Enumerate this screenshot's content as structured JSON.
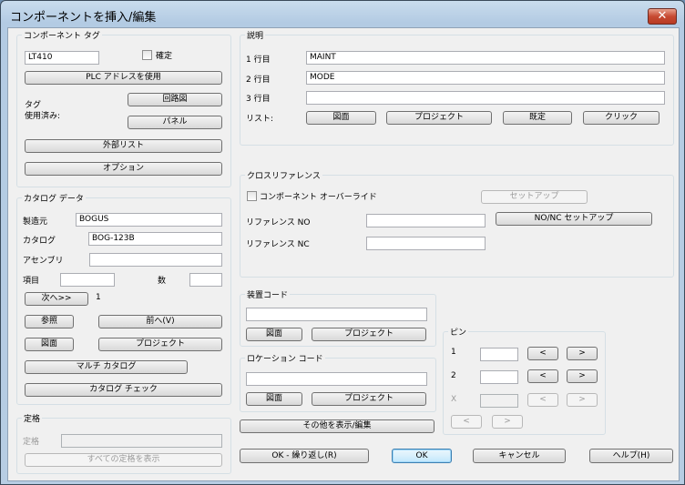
{
  "window": {
    "title": "コンポーネントを挿入/編集",
    "close_glyph": "✕"
  },
  "component_tag": {
    "legend": "コンポーネント タグ",
    "tag_value": "LT410",
    "fixed_label": "確定",
    "plc_button": "PLC アドレスを使用",
    "tags_used_label": "タグ\n使用済み:",
    "schematic_button": "回路図",
    "panel_button": "パネル",
    "external_list_button": "外部リスト",
    "options_button": "オプション"
  },
  "catalog": {
    "legend": "カタログ データ",
    "manufacturer_label": "製造元",
    "manufacturer_value": "BOGUS",
    "catalog_label": "カタログ",
    "catalog_value": "BOG-123B",
    "assembly_label": "アセンブリ",
    "assembly_value": "",
    "item_label": "項目",
    "item_value": "",
    "count_label": "数",
    "count_value": "",
    "next_button": "次へ>>",
    "next_value": "1",
    "lookup_button": "参照",
    "previous_button": "前へ(V)",
    "drawing_button": "図面",
    "project_button": "プロジェクト",
    "multi_catalog_button": "マルチ カタログ",
    "catalog_check_button": "カタログ チェック"
  },
  "rating": {
    "legend": "定格",
    "rating_label": "定格",
    "rating_value": "",
    "show_all_button": "すべての定格を表示"
  },
  "description": {
    "legend": "説明",
    "line1_label": "1 行目",
    "line1_value": "MAINT",
    "line2_label": "2 行目",
    "line2_value": "MODE",
    "line3_label": "3 行目",
    "line3_value": "",
    "list_label": "リスト:",
    "drawing_button": "図面",
    "project_button": "プロジェクト",
    "defaults_button": "既定",
    "pick_button": "クリック"
  },
  "cross_reference": {
    "legend": "クロスリファレンス",
    "override_label": "コンポーネント オーバーライド",
    "setup_button": "セットアップ",
    "ref_no_label": "リファレンス NO",
    "ref_no_value": "",
    "ref_nc_label": "リファレンス NC",
    "ref_nc_value": "",
    "nonc_setup_button": "NO/NC セットアップ"
  },
  "installation_code": {
    "legend": "装置コード",
    "value": "",
    "drawing_button": "図面",
    "project_button": "プロジェクト"
  },
  "location_code": {
    "legend": "ロケーション コード",
    "value": "",
    "drawing_button": "図面",
    "project_button": "プロジェクト"
  },
  "pins": {
    "legend": "ピン",
    "row1_label": "1",
    "row2_label": "2",
    "rowx_label": "X",
    "row1_value": "",
    "row2_value": "",
    "rowx_value": "",
    "prev_glyph": "<",
    "next_glyph": ">"
  },
  "footer": {
    "show_edit_button": "その他を表示/編集",
    "ok_repeat_button": "OK - 繰り返し(R)",
    "ok_button": "OK",
    "cancel_button": "キャンセル",
    "help_button": "ヘルプ(H)"
  }
}
